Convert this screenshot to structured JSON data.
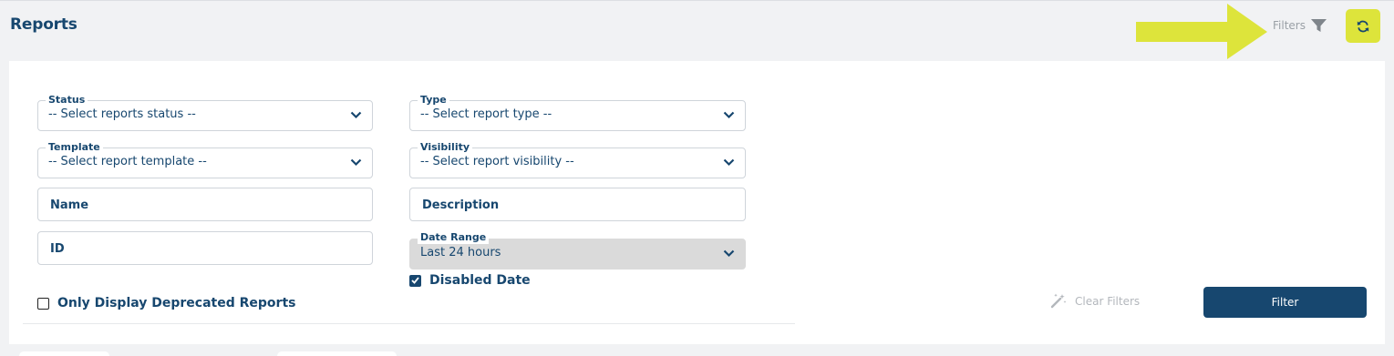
{
  "header": {
    "title": "Reports",
    "filters_label": "Filters",
    "refresh_icon": "refresh-icon",
    "accent_color": "#dde43b",
    "arrow_color": "#dde43b"
  },
  "filters": {
    "status": {
      "legend": "Status",
      "value": "-- Select reports status --"
    },
    "type": {
      "legend": "Type",
      "value": "-- Select report type --"
    },
    "template": {
      "legend": "Template",
      "value": "-- Select report template --"
    },
    "visibility": {
      "legend": "Visibility",
      "value": "-- Select report visibility --"
    },
    "name": {
      "placeholder": "Name"
    },
    "description": {
      "placeholder": "Description"
    },
    "id": {
      "placeholder": "ID"
    },
    "date_range": {
      "legend": "Date Range",
      "value": "Last 24 hours"
    },
    "disabled_date": {
      "label": "Disabled Date",
      "checked": true
    },
    "deprecated": {
      "label": "Only Display Deprecated Reports",
      "checked": false
    }
  },
  "actions": {
    "clear_label": "Clear Filters",
    "filter_label": "Filter",
    "primary_color": "#17476f"
  }
}
